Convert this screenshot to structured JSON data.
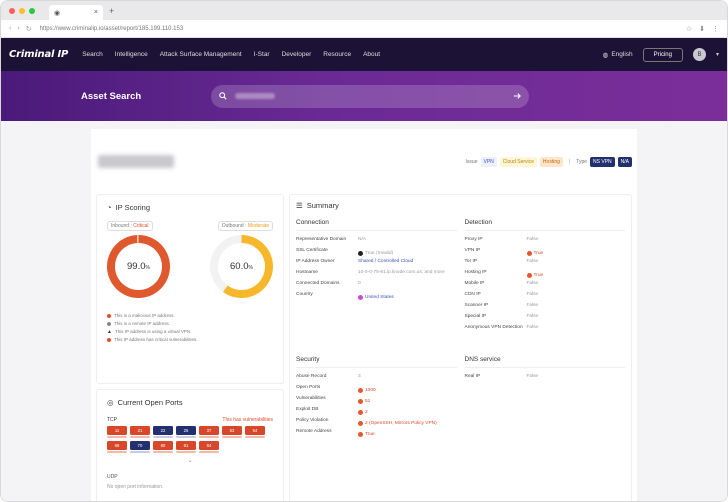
{
  "browser": {
    "tab_close": "×",
    "new_tab": "+",
    "nav_icons": [
      "‹",
      "›",
      "↻"
    ],
    "url": "https://www.criminalip.io/asset/report/185.199.110.153",
    "right_icons": [
      "☆",
      "⬇",
      "⋮"
    ]
  },
  "nav": {
    "logo": "Criminal IP",
    "menu": [
      "Search",
      "Intelligence",
      "Attack Surface Management",
      "I-Star",
      "Developer",
      "Resource",
      "About"
    ],
    "language": "English",
    "pricing": "Pricing",
    "avatar": "B"
  },
  "hero": {
    "title": "Asset Search",
    "search_icon": "search-icon",
    "submit_icon": "arrow-right-icon"
  },
  "tags": {
    "prefix": "Issue",
    "items": [
      "VPN",
      "Cloud Service",
      "Hosting"
    ],
    "type_label": "Type",
    "types": [
      "NS VPN",
      "N/A"
    ]
  },
  "scoring": {
    "title": "IP Scoring",
    "inbound_label": "Inbound :",
    "inbound_level": "Critical",
    "outbound_label": "Outbound :",
    "outbound_level": "Moderate",
    "inbound_value": "99.0",
    "outbound_value": "60.0",
    "unit": "%",
    "notes": [
      "This is a malicious IP address.",
      "This is a remote IP address.",
      "This IP address is using a virtual VPN.",
      "This IP address has critical vulnerabilities."
    ]
  },
  "ports": {
    "title": "Current Open Ports",
    "tcp": "TCP",
    "warning": "This has vulnerabilities",
    "tcp_ports": [
      {
        "n": "11",
        "c": "r"
      },
      {
        "n": "21",
        "c": "r"
      },
      {
        "n": "22",
        "c": "b"
      },
      {
        "n": "25",
        "c": "b"
      },
      {
        "n": "37",
        "c": "r"
      },
      {
        "n": "53",
        "c": "r"
      },
      {
        "n": "64",
        "c": "r"
      },
      {
        "n": "68",
        "c": "r"
      },
      {
        "n": "70",
        "c": "b"
      },
      {
        "n": "80",
        "c": "r"
      },
      {
        "n": "81",
        "c": "r"
      },
      {
        "n": "84",
        "c": "r"
      }
    ],
    "expand": "⌄",
    "udp": "UDP",
    "udp_empty": "No open port information."
  },
  "summary": {
    "title": "Summary",
    "connection_title": "Connection",
    "connection": [
      {
        "k": "Representative Domain",
        "v": "N/A"
      },
      {
        "k": "SSL Certificate",
        "v": "True (Invalid)"
      },
      {
        "k": "IP Address Owner",
        "v": "Shared / Controlled Cloud"
      },
      {
        "k": "Hostname",
        "v": "10-0-0-75-91.ip.linode.com.us; and more"
      },
      {
        "k": "Connected Domains",
        "v": "0"
      },
      {
        "k": "Country",
        "v": "United States"
      }
    ],
    "detection_title": "Detection",
    "detection": [
      {
        "k": "Proxy IP",
        "v": "False"
      },
      {
        "k": "VPN IP",
        "v": "True"
      },
      {
        "k": "Tor IP",
        "v": "False"
      },
      {
        "k": "Hosting IP",
        "v": "True"
      },
      {
        "k": "Mobile IP",
        "v": "False"
      },
      {
        "k": "CDN IP",
        "v": "False"
      },
      {
        "k": "Scanner IP",
        "v": "False"
      },
      {
        "k": "Special IP",
        "v": "False"
      },
      {
        "k": "Anonymous VPN Detection",
        "v": "False"
      }
    ],
    "security_title": "Security",
    "security": [
      {
        "k": "Abuse Record",
        "v": "3"
      },
      {
        "k": "Open Ports",
        "v": "1000"
      },
      {
        "k": "Vulnerabilities",
        "v": "51"
      },
      {
        "k": "Exploit DB",
        "v": "2"
      },
      {
        "k": "Policy Violation",
        "v": "2 (OpenSSH, Mirrors Policy VPN)"
      },
      {
        "k": "Remote Address",
        "v": "True"
      }
    ],
    "dns_title": "DNS service",
    "dns": [
      {
        "k": "Real IP",
        "v": "False"
      }
    ]
  }
}
